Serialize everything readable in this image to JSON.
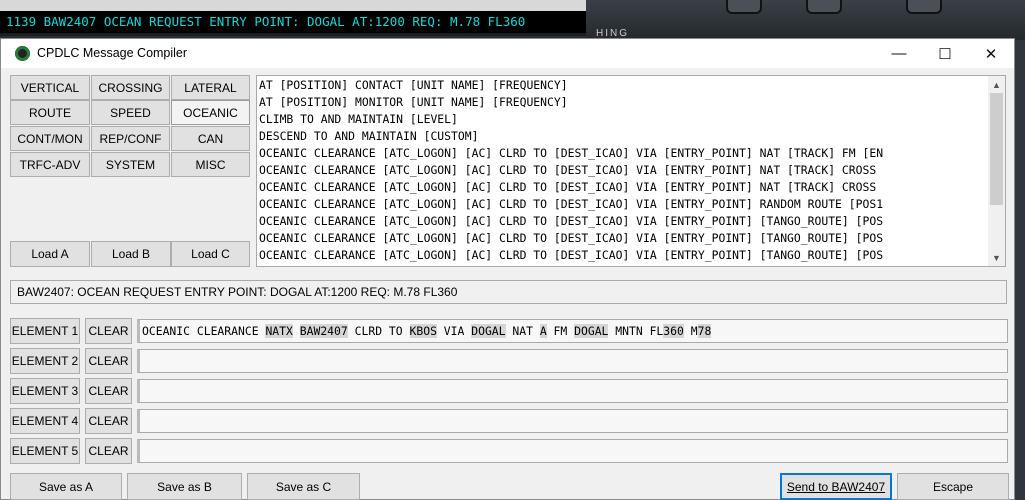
{
  "background": {
    "message": "1139 BAW2407 OCEAN REQUEST ENTRY POINT: DOGAL AT:1200 REQ: M.78 FL360",
    "panel_text": "HING"
  },
  "window": {
    "title": "CPDLC Message Compiler",
    "minimize": "—",
    "maximize": "☐",
    "close": "✕"
  },
  "categories": [
    {
      "label": "VERTICAL"
    },
    {
      "label": "CROSSING"
    },
    {
      "label": "LATERAL"
    },
    {
      "label": "ROUTE"
    },
    {
      "label": "SPEED"
    },
    {
      "label": "OCEANIC",
      "active": true
    },
    {
      "label": "CONT/MON"
    },
    {
      "label": "REP/CONF"
    },
    {
      "label": "CAN"
    },
    {
      "label": "TRFC-ADV"
    },
    {
      "label": "SYSTEM"
    },
    {
      "label": "MISC"
    }
  ],
  "load_buttons": [
    "Load A",
    "Load B",
    "Load C"
  ],
  "templates": [
    "AT [POSITION] CONTACT [UNIT NAME] [FREQUENCY]",
    "AT [POSITION] MONITOR [UNIT NAME] [FREQUENCY]",
    "CLIMB TO AND MAINTAIN [LEVEL]",
    "DESCEND TO AND MAINTAIN [CUSTOM]",
    "OCEANIC CLEARANCE [ATC_LOGON] [AC] CLRD TO [DEST_ICAO] VIA [ENTRY_POINT] NAT [TRACK] FM [EN",
    "OCEANIC CLEARANCE [ATC_LOGON] [AC] CLRD TO [DEST_ICAO] VIA [ENTRY_POINT] NAT [TRACK] CROSS",
    "OCEANIC CLEARANCE [ATC_LOGON] [AC] CLRD TO [DEST_ICAO] VIA [ENTRY_POINT] NAT [TRACK] CROSS",
    "OCEANIC CLEARANCE [ATC_LOGON] [AC] CLRD TO [DEST_ICAO] VIA [ENTRY_POINT] RANDOM ROUTE [POS1",
    "OCEANIC CLEARANCE [ATC_LOGON] [AC] CLRD TO [DEST_ICAO] VIA [ENTRY_POINT] [TANGO_ROUTE] [POS",
    "OCEANIC CLEARANCE [ATC_LOGON] [AC] CLRD TO [DEST_ICAO] VIA [ENTRY_POINT] [TANGO_ROUTE] [POS",
    "OCEANIC CLEARANCE [ATC_LOGON] [AC] CLRD TO [DEST_ICAO] VIA [ENTRY_POINT] [TANGO_ROUTE] [POS"
  ],
  "request_text": "BAW2407: OCEAN REQUEST ENTRY POINT: DOGAL AT:1200 REQ: M.78 FL360",
  "elements": [
    {
      "label": "ELEMENT 1",
      "clear": "CLEAR",
      "tokens": [
        {
          "t": "OCEANIC CLEARANCE ",
          "hl": false
        },
        {
          "t": "NATX",
          "hl": true
        },
        {
          "t": " ",
          "hl": false
        },
        {
          "t": "BAW2407",
          "hl": true
        },
        {
          "t": " CLRD TO ",
          "hl": false
        },
        {
          "t": "KBOS",
          "hl": true
        },
        {
          "t": " VIA ",
          "hl": false
        },
        {
          "t": "DOGAL",
          "hl": true
        },
        {
          "t": " NAT ",
          "hl": false
        },
        {
          "t": "A",
          "hl": true
        },
        {
          "t": " FM ",
          "hl": false
        },
        {
          "t": "DOGAL",
          "hl": true
        },
        {
          "t": " MNTN FL",
          "hl": false
        },
        {
          "t": "360",
          "hl": true
        },
        {
          "t": " M",
          "hl": false
        },
        {
          "t": "78",
          "hl": true
        }
      ]
    },
    {
      "label": "ELEMENT 2",
      "clear": "CLEAR",
      "tokens": []
    },
    {
      "label": "ELEMENT 3",
      "clear": "CLEAR",
      "tokens": []
    },
    {
      "label": "ELEMENT 4",
      "clear": "CLEAR",
      "tokens": []
    },
    {
      "label": "ELEMENT 5",
      "clear": "CLEAR",
      "tokens": []
    }
  ],
  "bottom": {
    "save_a": "Save as A",
    "save_b": "Save as B",
    "save_c": "Save as C",
    "send": "Send to BAW2407",
    "escape": "Escape"
  }
}
